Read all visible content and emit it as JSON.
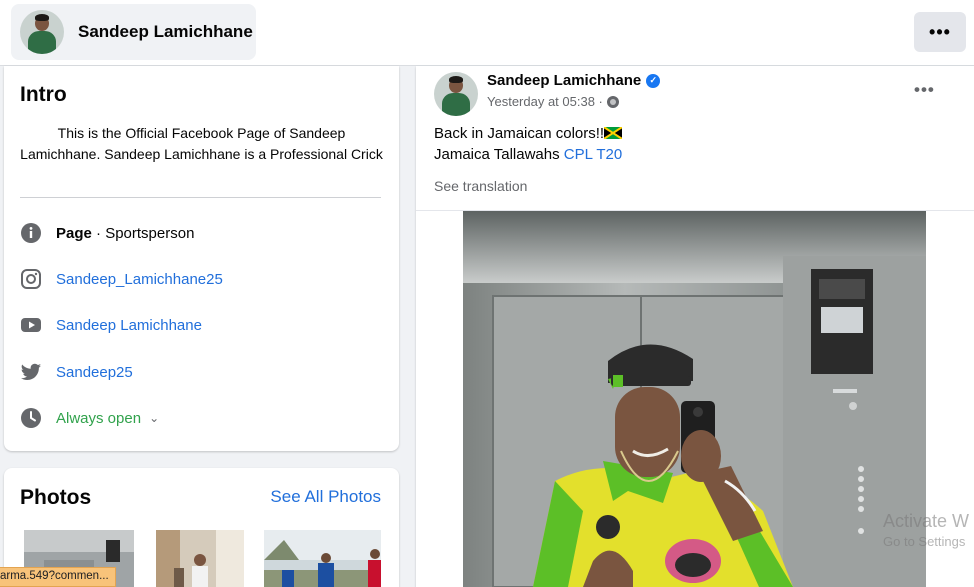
{
  "header": {
    "page_name": "Sandeep Lamichhane",
    "more_icon": "more-horizontal-icon"
  },
  "intro": {
    "title": "Intro",
    "bio": "This is the Official Facebook Page of Sandeep Lamichhane. Sandeep Lamichhane is a Professional Crick",
    "rows": [
      {
        "icon": "info-icon",
        "bold": "Page",
        "text": " · Sportsperson"
      },
      {
        "icon": "instagram-icon",
        "text": "Sandeep_Lamichhane25"
      },
      {
        "icon": "youtube-icon",
        "text": "Sandeep Lamichhane"
      },
      {
        "icon": "twitter-icon",
        "text": "Sandeep25"
      },
      {
        "icon": "clock-icon",
        "text": "Always open"
      }
    ]
  },
  "photos": {
    "title": "Photos",
    "see_all": "See All Photos"
  },
  "post": {
    "author": "Sandeep Lamichhane",
    "verified": true,
    "time": "Yesterday at 05:38 ·",
    "line1": "Back in Jamaican colors!!",
    "line2_prefix": "Jamaica Tallawahs ",
    "line2_tag": "CPL T20",
    "see_translation": "See translation"
  },
  "overlay": {
    "activate_title": "Activate W",
    "activate_sub": "Go to Settings",
    "status_url": "arma.549?commen..."
  },
  "colors": {
    "link": "#216fdb",
    "open_status": "#31a24c",
    "verified": "#1877f2",
    "jersey_green": "#5cbf27",
    "jersey_yellow": "#e3e02c"
  }
}
